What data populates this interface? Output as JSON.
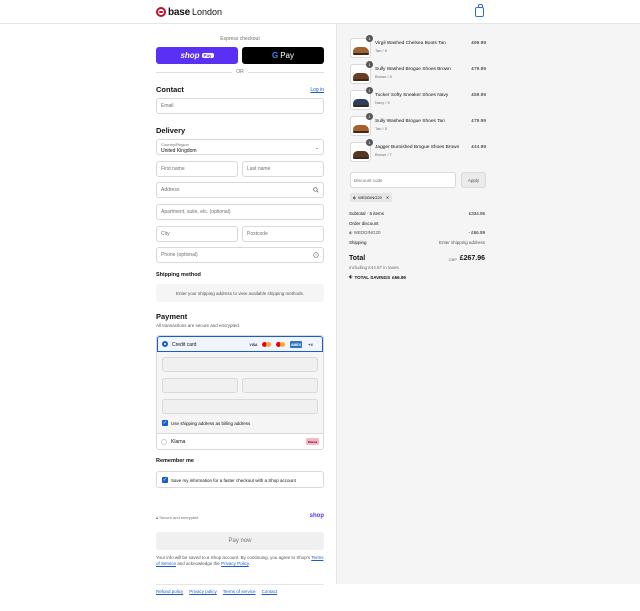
{
  "header": {
    "brand": "base",
    "brand_sub": "London"
  },
  "express": {
    "label": "Express checkout",
    "shop_pay_label": "shop",
    "shop_pay_badge": "Pay",
    "gpay_g": "G",
    "gpay_label": "Pay",
    "or": "OR"
  },
  "contact": {
    "heading": "Contact",
    "login": "Log in",
    "email_placeholder": "Email"
  },
  "delivery": {
    "heading": "Delivery",
    "country_label": "Country/Region",
    "country_value": "United Kingdom",
    "first_name": "First name",
    "last_name": "Last name",
    "address": "Address",
    "apartment": "Apartment, suite, etc. (optional)",
    "city": "City",
    "postcode": "Postcode",
    "phone": "Phone (optional)"
  },
  "shipping": {
    "heading": "Shipping method",
    "message": "Enter your shipping address to view available shipping methods."
  },
  "payment": {
    "heading": "Payment",
    "subtitle": "All transactions are secure and encrypted.",
    "credit_card": "Credit card",
    "cards": [
      "VISA",
      "AMEX",
      "+4"
    ],
    "billing_checkbox": "Use shipping address as billing address",
    "klarna": "Klarna",
    "klarna_badge": "Klarna"
  },
  "remember": {
    "heading": "Remember me",
    "checkbox": "Save my information for a faster checkout with a Shop account",
    "secure": "Secure and encrypted",
    "shop": "shop"
  },
  "pay_now": "Pay now",
  "legal": {
    "text_1": "Your info will be saved to a Shop account. By continuing, you agree to Shop's",
    "terms": "Terms of Service",
    "text_2": "and acknowledge the",
    "privacy": "Privacy Policy",
    "end": "."
  },
  "footer_links": [
    "Refund policy",
    "Privacy policy",
    "Terms of service",
    "Contact"
  ],
  "cart": {
    "items": [
      {
        "qty": "1",
        "name": "Virgil Washed Chelsea Boots Tan",
        "variant": "Tan / 6",
        "price": "£69.99",
        "color": "#a0622e"
      },
      {
        "qty": "1",
        "name": "Sully Washed Brogue Shoes Brown",
        "variant": "Brown / 5",
        "price": "£79.99",
        "color": "#6b3d22"
      },
      {
        "qty": "1",
        "name": "Tucker Softy Sneaker Shoes Navy",
        "variant": "Navy / 5",
        "price": "£59.99",
        "color": "#2c3e5f"
      },
      {
        "qty": "1",
        "name": "Sully Washed Brogue Shoes Tan",
        "variant": "Tan / 5",
        "price": "£79.99",
        "color": "#a8612a"
      },
      {
        "qty": "1",
        "name": "Jagger Burnished Brogue Shoes Brown",
        "variant": "Brown / 7",
        "price": "£44.99",
        "color": "#5a3520"
      }
    ],
    "discount_placeholder": "Discount code",
    "apply": "Apply",
    "code_tag": "WEDDING20",
    "subtotal_label": "Subtotal · 5 items",
    "subtotal_value": "£334.95",
    "order_discount_label": "Order discount",
    "discount_code": "WEDDING20",
    "discount_value": "- £66.99",
    "shipping_label": "Shipping",
    "shipping_value": "Enter shipping address",
    "total_label": "Total",
    "currency": "GBP",
    "total_value": "£267.96",
    "tax_note": "Including £44.67 in taxes",
    "savings_label": "TOTAL SAVINGS",
    "savings_value": "£66.99"
  }
}
